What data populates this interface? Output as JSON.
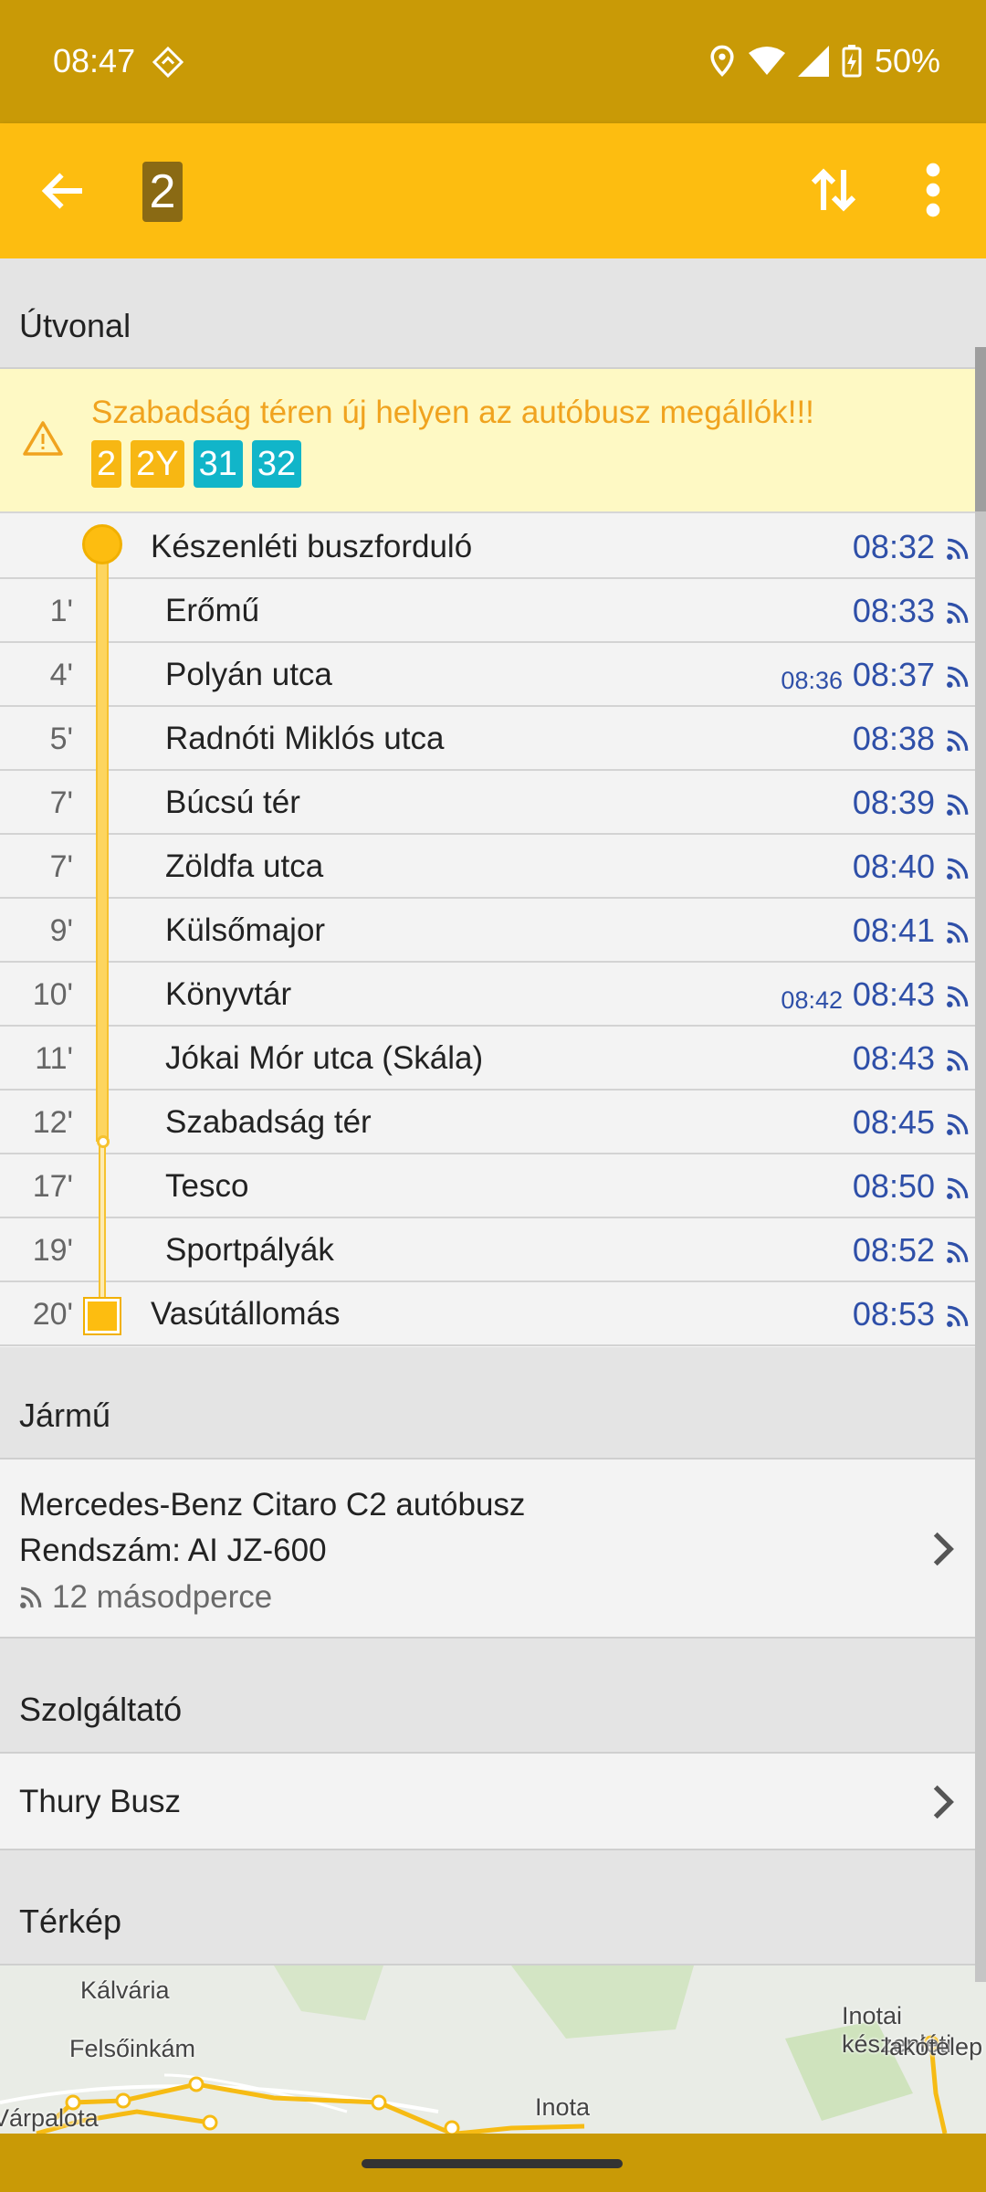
{
  "status_bar": {
    "time": "08:47",
    "battery": "50%"
  },
  "app_bar": {
    "route_number": "2"
  },
  "sections": {
    "route": "Útvonal",
    "vehicle": "Jármű",
    "provider": "Szolgáltató",
    "map": "Térkép"
  },
  "alert": {
    "text": "Szabadság téren új helyen az autóbusz megállók!!!",
    "routes": [
      {
        "label": "2",
        "color": "#f7b713"
      },
      {
        "label": "2Y",
        "color": "#f7b713"
      },
      {
        "label": "31",
        "color": "#11b5c9"
      },
      {
        "label": "32",
        "color": "#11b5c9"
      }
    ]
  },
  "stops": [
    {
      "minute": "",
      "name": "Készenléti buszforduló",
      "scheduled": "",
      "time": "08:32"
    },
    {
      "minute": "1'",
      "name": "Erőmű",
      "scheduled": "",
      "time": "08:33"
    },
    {
      "minute": "4'",
      "name": "Polyán utca",
      "scheduled": "08:36",
      "time": "08:37"
    },
    {
      "minute": "5'",
      "name": "Radnóti Miklós utca",
      "scheduled": "",
      "time": "08:38"
    },
    {
      "minute": "7'",
      "name": "Búcsú tér",
      "scheduled": "",
      "time": "08:39"
    },
    {
      "minute": "7'",
      "name": "Zöldfa utca",
      "scheduled": "",
      "time": "08:40"
    },
    {
      "minute": "9'",
      "name": "Külsőmajor",
      "scheduled": "",
      "time": "08:41"
    },
    {
      "minute": "10'",
      "name": "Könyvtár",
      "scheduled": "08:42",
      "time": "08:43"
    },
    {
      "minute": "11'",
      "name": "Jókai Mór utca (Skála)",
      "scheduled": "",
      "time": "08:43"
    },
    {
      "minute": "12'",
      "name": "Szabadság tér",
      "scheduled": "",
      "time": "08:45"
    },
    {
      "minute": "17'",
      "name": "Tesco",
      "scheduled": "",
      "time": "08:50"
    },
    {
      "minute": "19'",
      "name": "Sportpályák",
      "scheduled": "",
      "time": "08:52"
    },
    {
      "minute": "20'",
      "name": "Vasútállomás",
      "scheduled": "",
      "time": "08:53"
    }
  ],
  "vehicle": {
    "model": "Mercedes-Benz Citaro C2 autóbusz",
    "plate": "Rendszám: AI JZ-600",
    "last_update": "12 másodperce"
  },
  "provider": {
    "name": "Thury Busz"
  },
  "map": {
    "labels": [
      "Kálvária",
      "Felsőinkám",
      "Várpalota",
      "Inota",
      "Inotai készenléti",
      "lakótelep"
    ]
  },
  "colors": {
    "accent": "#fdbd10",
    "status_bar": "#c99a06",
    "time_blue": "#2e4fa8",
    "alert_orange": "#f0a31f"
  }
}
